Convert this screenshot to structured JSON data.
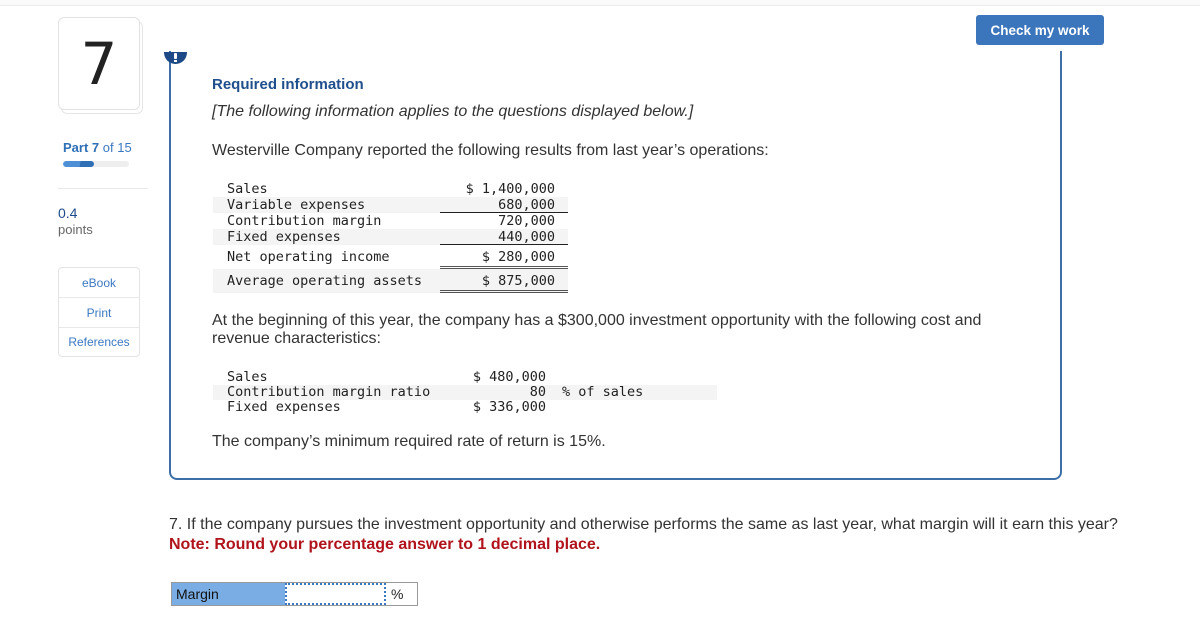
{
  "sidebar": {
    "question_number": "7",
    "part": {
      "prefix": "Part",
      "current": "7",
      "of_text": "of 15",
      "progress_fraction": 0.467
    },
    "points": {
      "value": "0.4",
      "label": "points"
    },
    "links": [
      {
        "label": "eBook"
      },
      {
        "label": "Print"
      },
      {
        "label": "References"
      }
    ]
  },
  "toolbar": {
    "check_my_work_label": "Check my work"
  },
  "info": {
    "title": "Required information",
    "subtitle": "[The following information applies to the questions displayed below.]",
    "intro": "Westerville Company reported the following results from last year’s operations:",
    "last_year_table": [
      {
        "label": "Sales",
        "value": "$ 1,400,000"
      },
      {
        "label": "Variable expenses",
        "value": "680,000"
      },
      {
        "label": "Contribution margin",
        "value": "720,000"
      },
      {
        "label": "Fixed expenses",
        "value": "440,000"
      },
      {
        "label": "Net operating income",
        "value": "$ 280,000"
      },
      {
        "label": "Average operating assets",
        "value": "$ 875,000"
      }
    ],
    "opportunity_text": "At the beginning of this year, the company has a $300,000 investment opportunity with the following cost and revenue characteristics:",
    "opportunity_table": [
      {
        "label": "Sales",
        "value": "$ 480,000",
        "unit": ""
      },
      {
        "label": "Contribution margin ratio",
        "value": "80",
        "unit": "% of sales"
      },
      {
        "label": "Fixed expenses",
        "value": "$ 336,000",
        "unit": ""
      }
    ],
    "min_rate_text": "The company’s minimum required rate of return is 15%."
  },
  "question": {
    "text": "7. If the company pursues the investment opportunity and otherwise performs the same as last year, what margin will it earn this year?",
    "note": "Note: Round your percentage answer to 1 decimal place.",
    "answer": {
      "label": "Margin",
      "value": "",
      "placeholder": "",
      "unit": "%"
    }
  },
  "colors": {
    "accent": "#3b75bb",
    "badge": "#1d4a86",
    "note_red": "#b0131c",
    "answer_label_bg": "#7aade3"
  }
}
